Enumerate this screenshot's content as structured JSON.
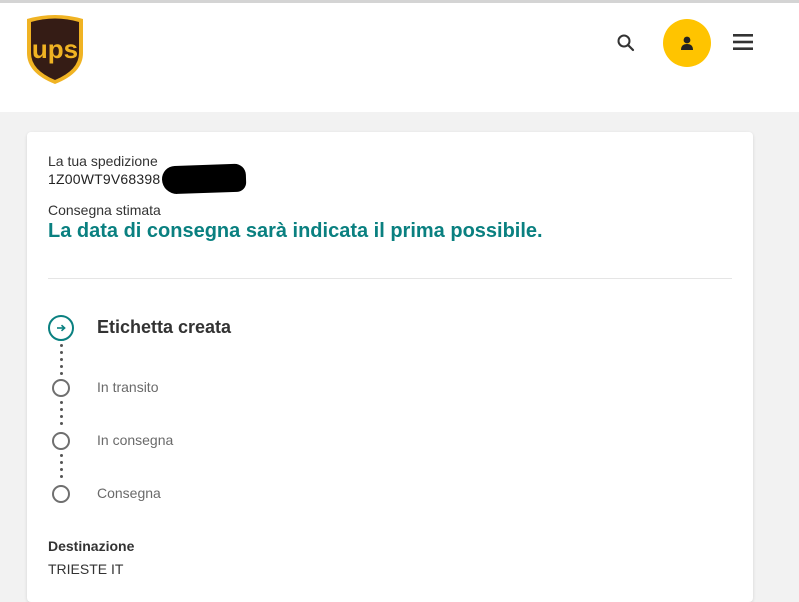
{
  "header": {
    "brand": "ups",
    "icons": {
      "search": "search-icon",
      "profile": "user-icon",
      "menu": "menu-icon"
    },
    "colors": {
      "brand_brown": "#351c15",
      "brand_gold": "#ffb500",
      "profile_bg": "#ffc400"
    }
  },
  "shipment": {
    "heading": "La tua spedizione",
    "tracking_number": "1Z00WT9V68398",
    "estimate_label": "Consegna stimata",
    "estimate_text": "La data di consegna sarà indicata il prima possibile.",
    "accent_color": "#0a8080"
  },
  "progress": {
    "steps": [
      {
        "label": "Etichetta creata",
        "status": "current"
      },
      {
        "label": "In transito",
        "status": "pending"
      },
      {
        "label": "In consegna",
        "status": "pending"
      },
      {
        "label": "Consegna",
        "status": "pending"
      }
    ]
  },
  "destination": {
    "label": "Destinazione",
    "value": "TRIESTE IT"
  }
}
